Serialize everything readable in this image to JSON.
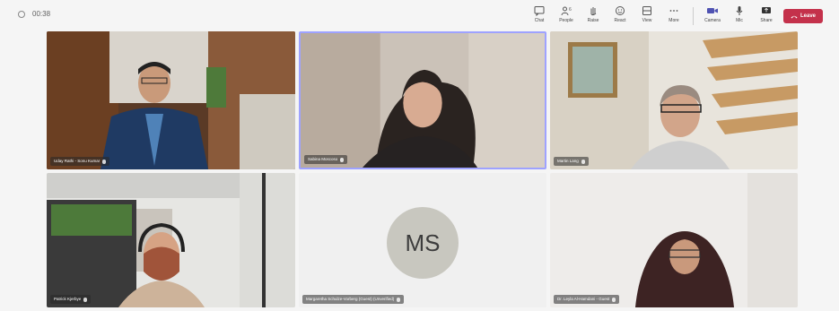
{
  "meeting": {
    "timer": "00:38"
  },
  "toolbar": {
    "chat_label": "Chat",
    "people_label": "People",
    "people_count": "6",
    "raise_label": "Raise",
    "react_label": "React",
    "view_label": "View",
    "more_label": "More",
    "camera_label": "Camera",
    "mic_label": "Mic",
    "share_label": "Share",
    "leave_label": "Leave"
  },
  "participants": [
    {
      "name": "Uday Rathi - Sonu Kumar",
      "avatar": "",
      "speaking": false
    },
    {
      "name": "Sabina Moscoso",
      "avatar": "",
      "speaking": true
    },
    {
      "name": "Martin Lang",
      "avatar": "",
      "speaking": false
    },
    {
      "name": "Patrick Kjerbye",
      "avatar": "",
      "speaking": false
    },
    {
      "name": "Margaretha Schulze-Vorberg (Guest) (Unverified)",
      "avatar": "MS",
      "speaking": false
    },
    {
      "name": "Dr. Leyla Al-Hamdani - Guest",
      "avatar": "",
      "speaking": false
    }
  ],
  "colors": {
    "leave": "#c4314b",
    "speaking_border": "#9ea2ff",
    "avatar_bg": "#c8c7bf"
  }
}
